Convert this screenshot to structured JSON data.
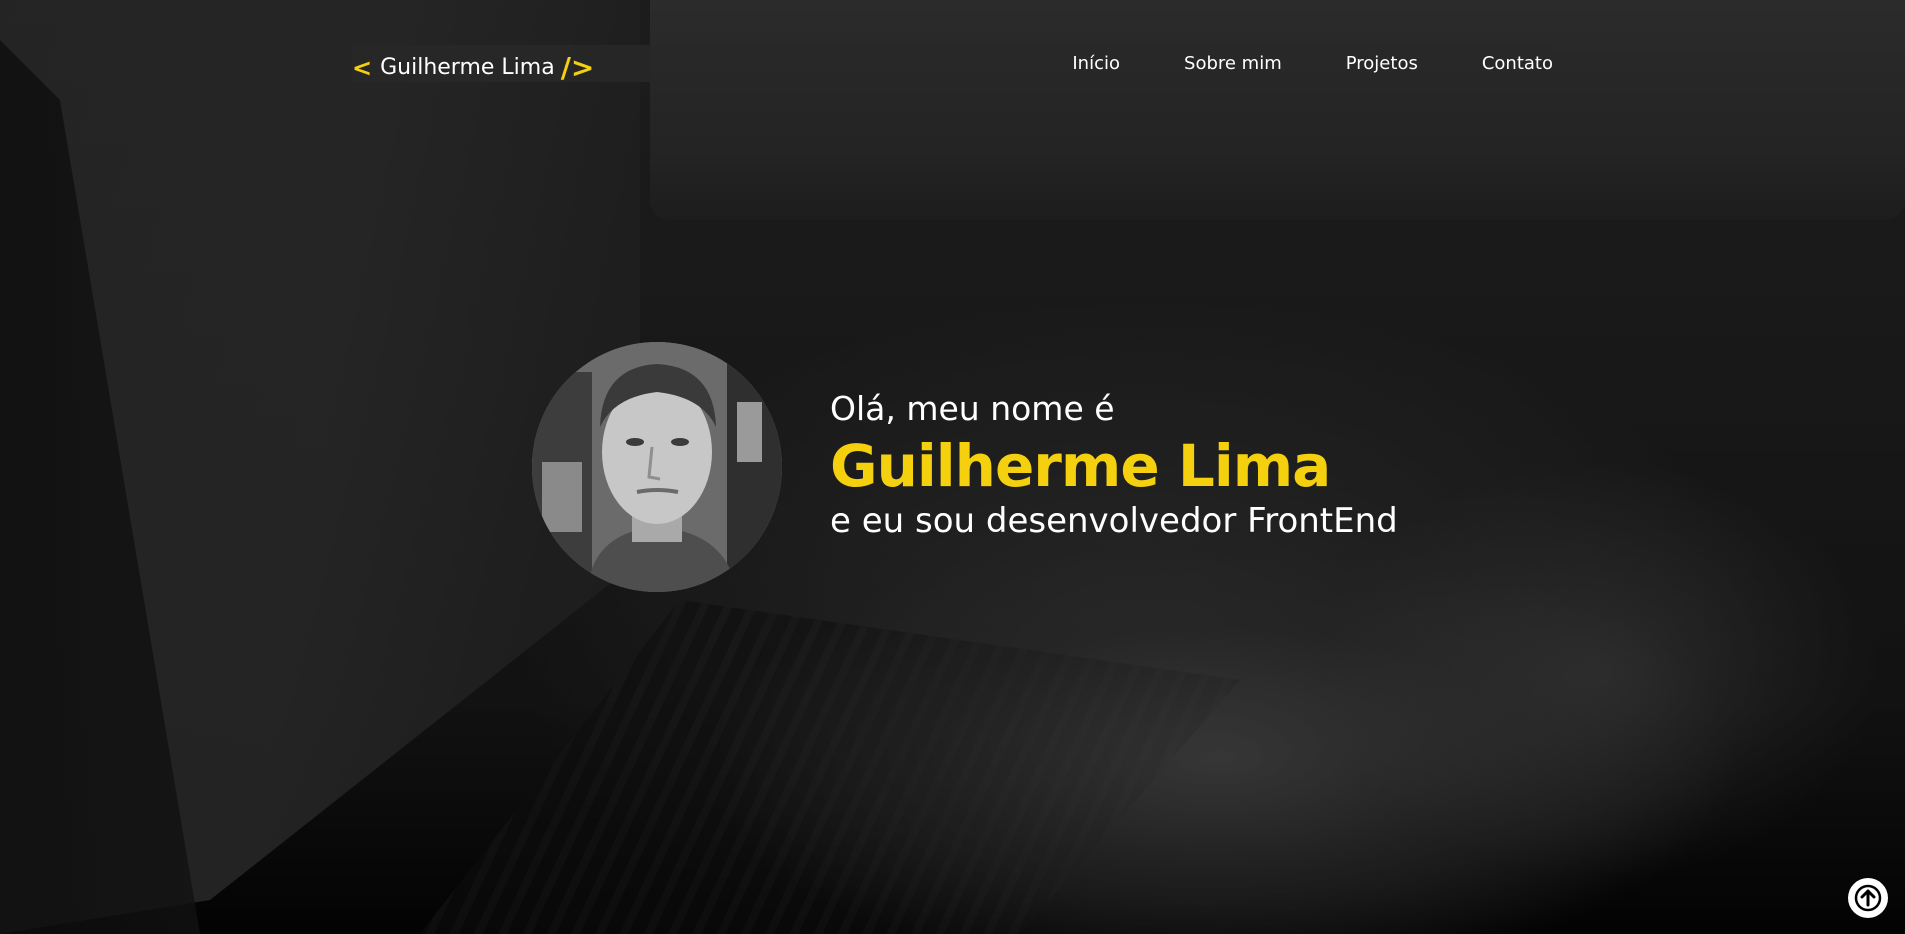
{
  "header": {
    "logo": {
      "left_bracket": "<",
      "name": "Guilherme Lima",
      "right_bracket": "/>"
    },
    "nav": [
      {
        "label": "Início"
      },
      {
        "label": "Sobre mim"
      },
      {
        "label": "Projetos"
      },
      {
        "label": "Contato"
      }
    ]
  },
  "hero": {
    "greeting": "Olá, meu nome é",
    "name": "Guilherme Lima",
    "role": "e eu sou desenvolvedor FrontEnd"
  },
  "back_to_top": {
    "icon": "arrow-up-icon"
  },
  "colors": {
    "accent": "#f5d00e",
    "text": "#ffffff",
    "header_bg": "#282828"
  }
}
